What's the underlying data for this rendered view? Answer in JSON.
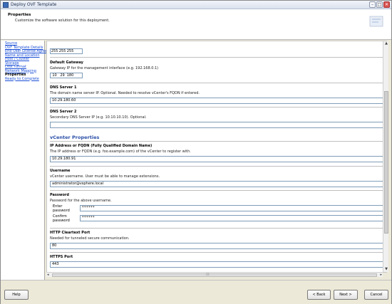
{
  "window": {
    "title": "Deploy OVF Template",
    "controls": [
      "–",
      "□",
      "✕"
    ]
  },
  "header": {
    "title": "Properties",
    "subtitle": "Customize the software solution for this deployment."
  },
  "nav": {
    "items": [
      {
        "label": "Source"
      },
      {
        "label": "OVF Template Details"
      },
      {
        "label": "End User License Agreement"
      },
      {
        "label": "Name and Location"
      },
      {
        "label": "Host / Cluster"
      },
      {
        "label": "Storage"
      },
      {
        "label": "Disk Format"
      },
      {
        "label": "Network Mapping"
      },
      {
        "label": "Properties"
      },
      {
        "label": "Ready to Complete"
      }
    ]
  },
  "form": {
    "netmask": {
      "octets": [
        "255",
        "255",
        "255",
        ""
      ]
    },
    "gateway": {
      "label": "Default Gateway",
      "desc": "Gateway IP for the management interface (e.g. 192.168.0.1)",
      "octets": [
        "10",
        "29",
        "180",
        ""
      ]
    },
    "dns1": {
      "label": "DNS Server 1",
      "desc": "The domain name server IP. Optional. Needed to resolve vCenter's FQDN if entered.",
      "value": "10.29.180.60"
    },
    "dns2": {
      "label": "DNS Server 2",
      "desc": "Secondary DNS Server IP (e.g. 10.10.10.10). Optional.",
      "value": ""
    },
    "vcenter_heading": "vCenter Properties",
    "fqdn": {
      "label": "IP Address or FQDN (Fully Qualified Domain Name)",
      "desc": "The IP address or FQDN (e.g. foo.example.com) of the vCenter to register with.",
      "value": "10.29.180.91"
    },
    "username": {
      "label": "Username",
      "desc": "vCenter username. User must be able to manage extensions.",
      "value": "administrator@vsphere.local"
    },
    "password": {
      "label": "Password",
      "desc": "Password for the above username.",
      "enter_label": "Enter password",
      "enter_value": "******",
      "confirm_label": "Confirm password",
      "confirm_value": "******"
    },
    "http_port": {
      "label": "HTTP Cleartext Port",
      "desc": "Needed for tunneled secure communication.",
      "value": "80"
    },
    "https_port": {
      "label": "HTTPS Port",
      "value": "443"
    }
  },
  "footer": {
    "help": "Help",
    "back": "< Back",
    "next": "Next >",
    "cancel": "Cancel"
  },
  "colors": {
    "link": "#1a4fd6",
    "group_heading": "#2a4ea8"
  }
}
